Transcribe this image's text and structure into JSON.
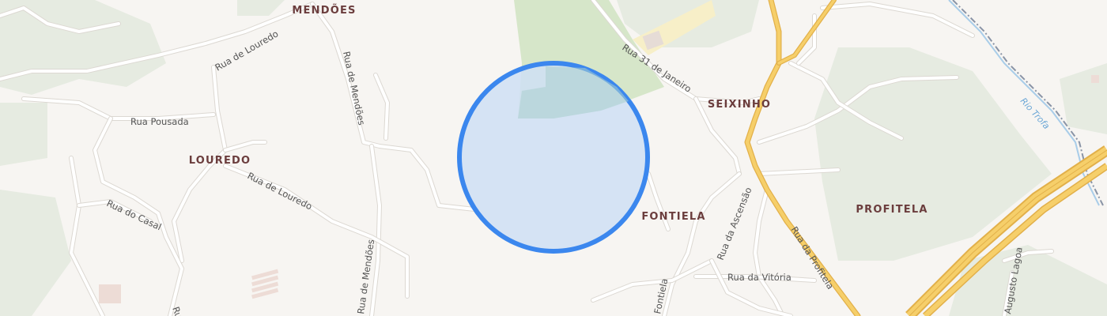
{
  "colors": {
    "background": "#f7f5f2",
    "forest": "#e6ebe1",
    "park": "#d6e6c9",
    "highway_casing": "#e2b04a",
    "highway_fill": "#f6cf6a",
    "marker_fill": "#cfdff5",
    "marker_stroke": "#3b87ee",
    "railway": "#8a94a6",
    "river": "#a9cde9"
  },
  "places": {
    "mendoes": "MENDÕES",
    "seixinho": "SEIXINHO",
    "louredo": "LOUREDO",
    "fontiela": "FONTIELA",
    "profitela": "PROFITELA"
  },
  "streets": {
    "rua_de_louredo_north": "Rua de Louredo",
    "rua_de_mendoes_north": "Rua de Mendões",
    "rua_pousada": "Rua Pousada",
    "rua_de_louredo_south": "Rua de Louredo",
    "rua_do_casal": "Rua do Casal",
    "rua_de_mendoes_south": "Rua de Mendões",
    "rua_31_de_janeiro": "Rua 31 de Janeiro",
    "rua_da_ascensao": "Rua da Ascensão",
    "rua_da_profitela": "Rua da Profitela",
    "rua_da_vitoria": "Rua da Vitória",
    "fontiela_road": "Fontiela",
    "augusto_lagoa": "Augusto Lagoa",
    "bottom_fragment": "Ru"
  },
  "water": {
    "river_label": "Rio Trofa"
  }
}
